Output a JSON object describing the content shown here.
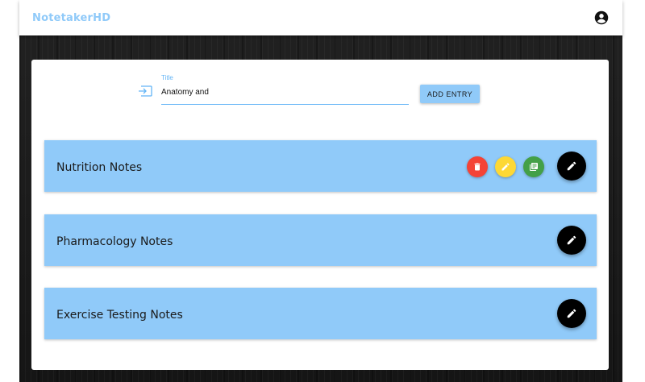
{
  "app": {
    "title": "NotetakerHD"
  },
  "appbar": {
    "account_icon": "account-circle-icon"
  },
  "entry_form": {
    "title_label": "Title",
    "title_value": "Anatomy and",
    "add_button_label": "ADD ENTRY",
    "icon": "input-icon"
  },
  "notes": [
    {
      "title": "Nutrition Notes",
      "actions_expanded": true
    },
    {
      "title": "Pharmacology Notes",
      "actions_expanded": false
    },
    {
      "title": "Exercise Testing Notes",
      "actions_expanded": false
    }
  ],
  "colors": {
    "accent": "#90caf9",
    "delete": "#f44336",
    "edit": "#fdd835",
    "open": "#43a047",
    "fab": "#000000"
  }
}
